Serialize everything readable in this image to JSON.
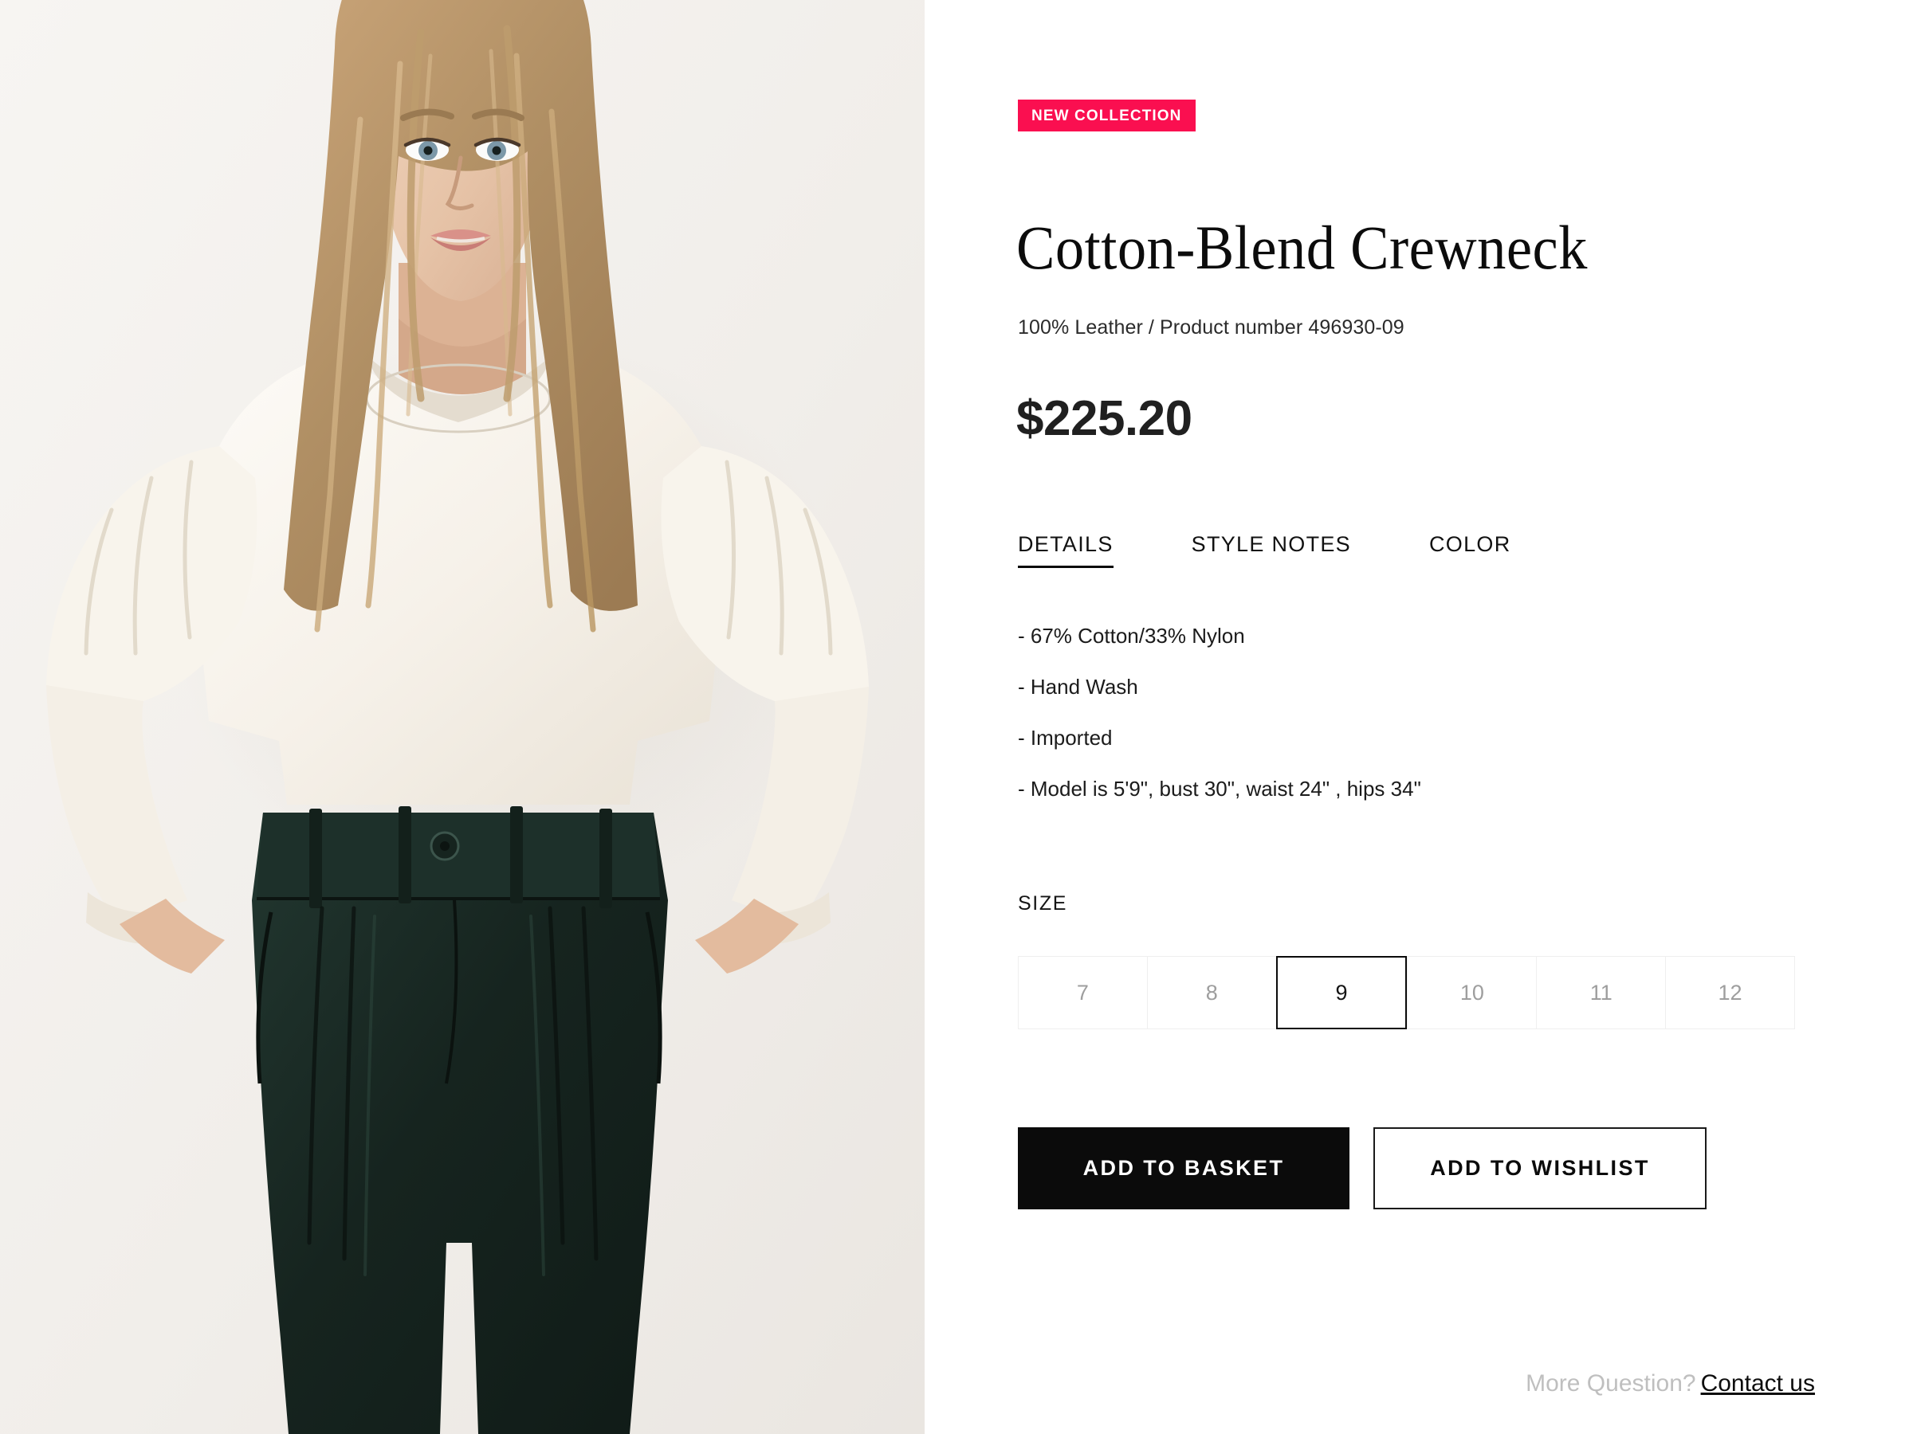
{
  "product": {
    "badge": "NEW COLLECTION",
    "title": "Cotton-Blend Crewneck",
    "subtitle": "100% Leather / Product number 496930-09",
    "price": "$225.20"
  },
  "tabs": [
    {
      "label": "DETAILS",
      "active": true
    },
    {
      "label": "STYLE NOTES",
      "active": false
    },
    {
      "label": "COLOR",
      "active": false
    }
  ],
  "details": [
    "- 67% Cotton/33% Nylon",
    "- Hand Wash",
    "- Imported",
    "- Model is 5'9\", bust 30\", waist 24\" , hips 34\""
  ],
  "size": {
    "label": "SIZE",
    "options": [
      "7",
      "8",
      "9",
      "10",
      "11",
      "12"
    ],
    "selected": "9"
  },
  "actions": {
    "basket": "ADD TO BASKET",
    "wishlist": "ADD TO WISHLIST"
  },
  "footer": {
    "question": "More Question?",
    "link": "Contact us"
  },
  "colors": {
    "badge_pink": "#fa0f50",
    "basket_black": "#0b0b0b",
    "selected_border": "#0a0a0a",
    "muted_gray": "#bfbfbf"
  },
  "gallery": {
    "alt": "model wearing cream ruffle-sleeve blouse and dark green pleated trousers",
    "background": "#f4f1ee"
  }
}
